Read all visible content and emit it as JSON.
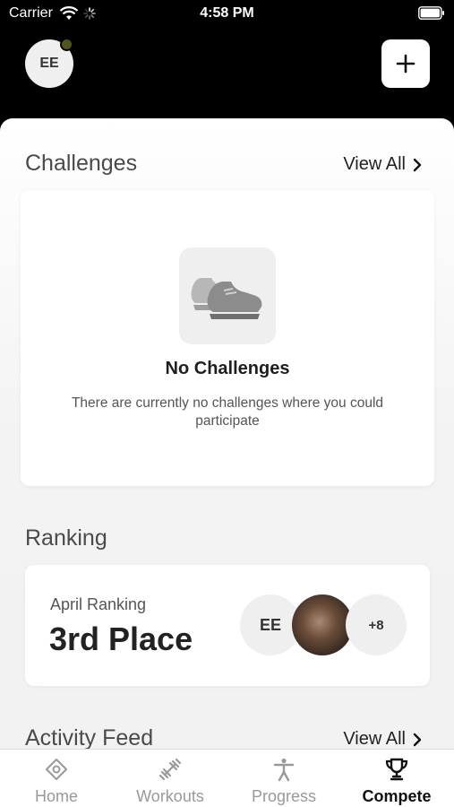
{
  "status_bar": {
    "carrier": "Carrier",
    "time": "4:58 PM"
  },
  "header": {
    "avatar_initials": "EE",
    "add_icon": "plus-icon"
  },
  "challenges": {
    "title": "Challenges",
    "view_all": "View All",
    "empty_icon": "sneaker-icon",
    "empty_title": "No Challenges",
    "empty_desc": "There are currently no challenges where you could participate"
  },
  "ranking": {
    "title": "Ranking",
    "label": "April Ranking",
    "value": "3rd Place",
    "avatars": {
      "user_initials": "EE",
      "more": "+8"
    }
  },
  "activity": {
    "title": "Activity Feed",
    "view_all": "View All"
  },
  "tabs": [
    {
      "label": "Home",
      "icon": "home-diamond-icon"
    },
    {
      "label": "Workouts",
      "icon": "dumbbell-icon"
    },
    {
      "label": "Progress",
      "icon": "person-icon"
    },
    {
      "label": "Compete",
      "icon": "trophy-icon"
    }
  ],
  "colors": {
    "active_tab": "#111111",
    "inactive_tab": "#999999",
    "online_dot": "#52541f"
  }
}
